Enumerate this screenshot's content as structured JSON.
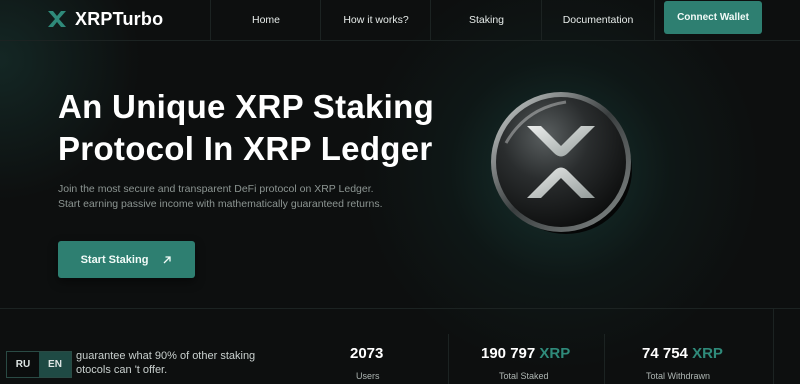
{
  "brand": {
    "name": "XRPTurbo"
  },
  "nav": {
    "items": [
      "Home",
      "How it works?",
      "Staking",
      "Documentation"
    ],
    "connect_label": "Connect Wallet"
  },
  "hero": {
    "title_line1": "An Unique XRP Staking",
    "title_line2": "Protocol In XRP Ledger",
    "desc_line1": "Join the most secure and transparent DeFi protocol on XRP Ledger.",
    "desc_line2": "Start earning passive income with mathematically guaranteed returns.",
    "cta_label": "Start Staking"
  },
  "stats": {
    "guarantee_line1": "guarantee what 90% of other staking",
    "guarantee_line2": "otocols can 't offer.",
    "users": {
      "value": "2073",
      "label": "Users"
    },
    "staked": {
      "value": "190 797",
      "unit": "XRP",
      "label": "Total Staked"
    },
    "withdrawn": {
      "value": "74 754",
      "unit": "XRP",
      "label": "Total Withdrawn"
    }
  },
  "lang": {
    "ru": "RU",
    "en": "EN",
    "active": "EN"
  },
  "colors": {
    "accent": "#2e7f71",
    "background": "#0d0f0f",
    "unit": "#2f8a7a"
  }
}
